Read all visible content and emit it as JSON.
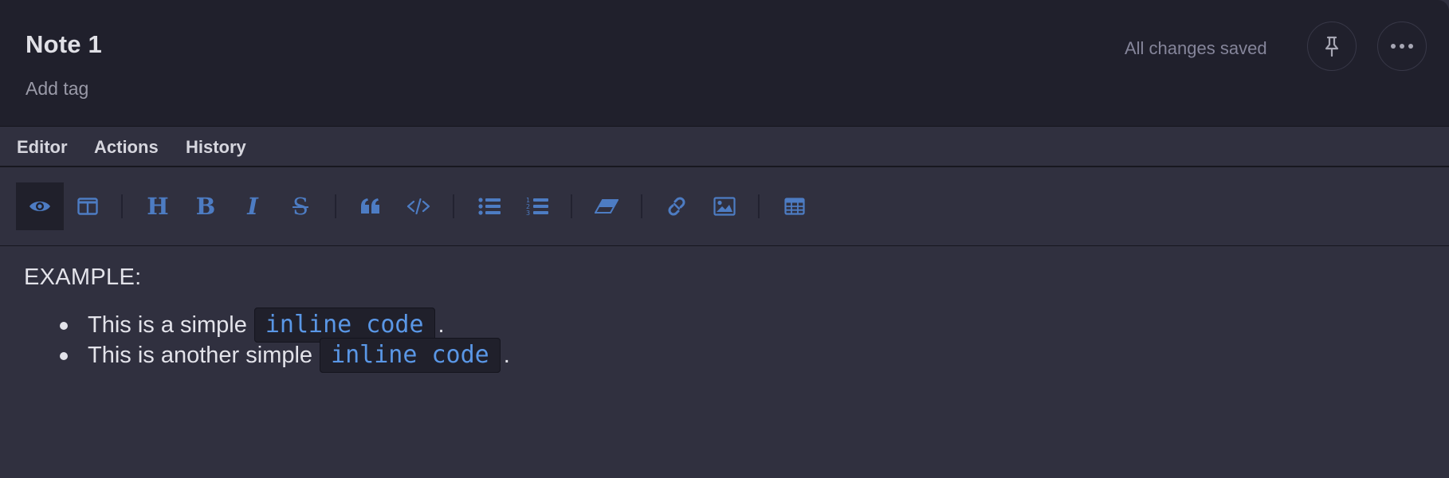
{
  "header": {
    "title": "Note 1",
    "tag_placeholder": "Add tag",
    "status": "All changes saved",
    "pin_icon": "pin-icon",
    "more_icon": "more-horizontal-icon"
  },
  "tabs": [
    {
      "label": "Editor"
    },
    {
      "label": "Actions"
    },
    {
      "label": "History"
    }
  ],
  "toolbar": {
    "items": [
      {
        "icon": "eye-icon",
        "active": true
      },
      {
        "icon": "side-by-side-icon"
      },
      {
        "icon": "heading-icon",
        "glyph": "H"
      },
      {
        "icon": "bold-icon",
        "glyph": "B"
      },
      {
        "icon": "italic-icon",
        "glyph": "I"
      },
      {
        "icon": "strikethrough-icon",
        "glyph": "S"
      },
      {
        "icon": "quote-icon"
      },
      {
        "icon": "code-icon"
      },
      {
        "icon": "unordered-list-icon"
      },
      {
        "icon": "ordered-list-icon"
      },
      {
        "icon": "eraser-icon"
      },
      {
        "icon": "link-icon"
      },
      {
        "icon": "image-icon"
      },
      {
        "icon": "table-icon"
      }
    ],
    "accent_color": "#4d7cc3"
  },
  "content": {
    "heading": "EXAMPLE:",
    "items": [
      {
        "before": "This is a simple",
        "code": "inline code",
        "after": "."
      },
      {
        "before": "This is another simple",
        "code": "inline code",
        "after": "."
      }
    ]
  },
  "colors": {
    "background": "#30303f",
    "header_background": "#20202c",
    "code_text": "#5a97e6"
  }
}
